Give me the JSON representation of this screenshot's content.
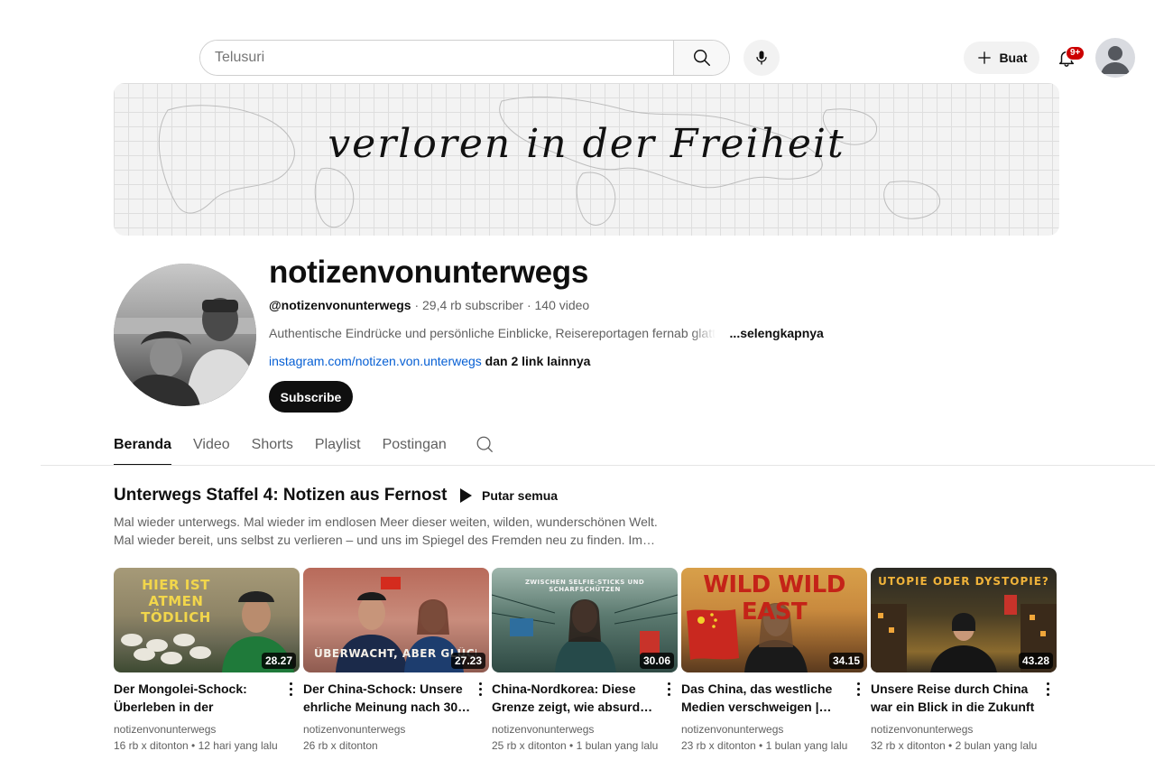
{
  "header": {
    "search": {
      "placeholder": "Telusuri"
    },
    "create_label": "Buat",
    "notification_badge": "9+",
    "icons": [
      "search-icon",
      "mic-icon",
      "plus-icon",
      "bell-icon",
      "user-avatar"
    ]
  },
  "banner": {
    "text": "verloren in der Freiheit"
  },
  "channel": {
    "name": "notizenvonunterwegs",
    "handle": "@notizenvonunterwegs",
    "stats": " · 29,4 rb subscriber · 140 video",
    "description": "Authentische Eindrücke und persönliche Einblicke, Reisereportagen fernab ",
    "description_fade": "glatt",
    "more_label": "...selengkapnya",
    "link": "instagram.com/notizen.von.unterwegs",
    "other_links": " dan 2 link lainnya",
    "subscribe_label": "Subscribe"
  },
  "tabs": [
    {
      "label": "Beranda",
      "active": true
    },
    {
      "label": "Video",
      "active": false
    },
    {
      "label": "Shorts",
      "active": false
    },
    {
      "label": "Playlist",
      "active": false
    },
    {
      "label": "Postingan",
      "active": false
    }
  ],
  "playlist": {
    "title": "Unterwegs Staffel 4: Notizen aus Fernost",
    "play_all_label": "Putar semua",
    "description_line1": "Mal wieder unterwegs. Mal wieder im endlosen Meer dieser weiten, wilden, wunderschönen Welt.",
    "description_line2": "Mal wieder bereit, uns selbst zu verlieren – und uns im Spiegel des Fremden neu zu finden. Im…"
  },
  "videos": [
    {
      "thumb_text": "HIER IST ATMEN TÖDLICH",
      "duration": "28.27",
      "title": "Der Mongolei-Schock: Überleben in der giftigsten…",
      "channel": "notizenvonunterwegs",
      "stats": "16 rb x ditonton • 12 hari yang lalu"
    },
    {
      "thumb_text": "ÜBERWACHT, ABER GLÜCKLICH?",
      "duration": "27.23",
      "title": "Der China-Schock: Unsere ehrliche Meinung nach 30…",
      "channel": "notizenvonunterwegs",
      "stats": "26 rb x ditonton"
    },
    {
      "thumb_text": "ZWISCHEN SELFIE-STICKS UND SCHARFSCHÜTZEN",
      "duration": "30.06",
      "title": "China-Nordkorea: Diese Grenze zeigt, wie absurd…",
      "channel": "notizenvonunterwegs",
      "stats": "25 rb x ditonton • 1 bulan yang lalu"
    },
    {
      "thumb_text": "WILD WILD EAST",
      "duration": "34.15",
      "title": "Das China, das westliche Medien verschweigen |…",
      "channel": "notizenvonunterwegs",
      "stats": "23 rb x ditonton • 1 bulan yang lalu"
    },
    {
      "thumb_text": "UTOPIE ODER DYSTOPIE?",
      "duration": "43.28",
      "title": "Unsere Reise durch China war ein Blick in die Zukunft |…",
      "channel": "notizenvonunterwegs",
      "stats": "32 rb x ditonton • 2 bulan yang lalu"
    }
  ]
}
